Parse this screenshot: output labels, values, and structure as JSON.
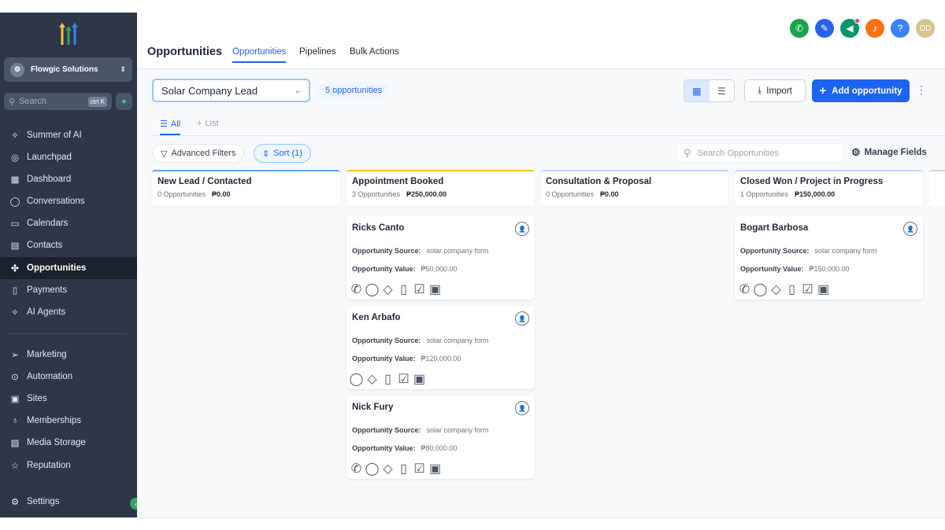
{
  "sidebar": {
    "org_name": "Flowgic Solutions",
    "search_placeholder": "Search",
    "search_shortcut": "ctrl K",
    "items": [
      {
        "label": "Summer of AI",
        "icon": "sparkle-icon"
      },
      {
        "label": "Launchpad",
        "icon": "launchpad-icon"
      },
      {
        "label": "Dashboard",
        "icon": "dashboard-icon"
      },
      {
        "label": "Conversations",
        "icon": "chat-icon"
      },
      {
        "label": "Calendars",
        "icon": "calendar-icon"
      },
      {
        "label": "Contacts",
        "icon": "contacts-icon"
      },
      {
        "label": "Opportunities",
        "icon": "opportunities-icon",
        "active": true
      },
      {
        "label": "Payments",
        "icon": "payments-icon"
      },
      {
        "label": "AI Agents",
        "icon": "ai-agents-icon"
      }
    ],
    "items2": [
      {
        "label": "Marketing",
        "icon": "send-icon"
      },
      {
        "label": "Automation",
        "icon": "automation-icon"
      },
      {
        "label": "Sites",
        "icon": "sites-icon"
      },
      {
        "label": "Memberships",
        "icon": "memberships-icon"
      },
      {
        "label": "Media Storage",
        "icon": "image-icon"
      },
      {
        "label": "Reputation",
        "icon": "star-icon"
      }
    ],
    "settings_label": "Settings"
  },
  "header": {
    "title": "Opportunities",
    "tabs": [
      "Opportunities",
      "Pipelines",
      "Bulk Actions"
    ],
    "avatar_initials": "OD"
  },
  "toolbar": {
    "pipeline": "Solar Company Lead",
    "count_label": "5 opportunities",
    "import_label": "Import",
    "add_label": "Add opportunity"
  },
  "subtabs": {
    "all": "All",
    "list": "List"
  },
  "filters": {
    "advanced": "Advanced Filters",
    "sort": "Sort (1)",
    "search_placeholder": "Search Opportunities",
    "manage_fields": "Manage Fields"
  },
  "columns": [
    {
      "name": "New Lead / Contacted",
      "count": "0 Opportunities",
      "total": "₱0.00",
      "color": "#60a5fa"
    },
    {
      "name": "Appointment Booked",
      "count": "3 Opportunities",
      "total": "₱250,000.00",
      "color": "#fbbf24"
    },
    {
      "name": "Consultation & Proposal",
      "count": "0 Opportunities",
      "total": "₱0.00",
      "color": "#c7d2fe"
    },
    {
      "name": "Closed Won / Project in Progress",
      "count": "1 Opportunities",
      "total": "₱150,000.00",
      "color": "#c7d2fe"
    }
  ],
  "card_labels": {
    "source": "Opportunity Source:",
    "value": "Opportunity Value:"
  },
  "cards": [
    {
      "name": "Ricks Canto",
      "source": "solar company form",
      "value": "₱50,000.00"
    },
    {
      "name": "Ken Arbafo",
      "source": "solar company form",
      "value": "₱120,000.00"
    },
    {
      "name": "Nick Fury",
      "source": "solar company form",
      "value": "₱80,000.00"
    },
    {
      "name": "Bogart Barbosa",
      "source": "solar company form",
      "value": "₱150,000.00"
    }
  ]
}
